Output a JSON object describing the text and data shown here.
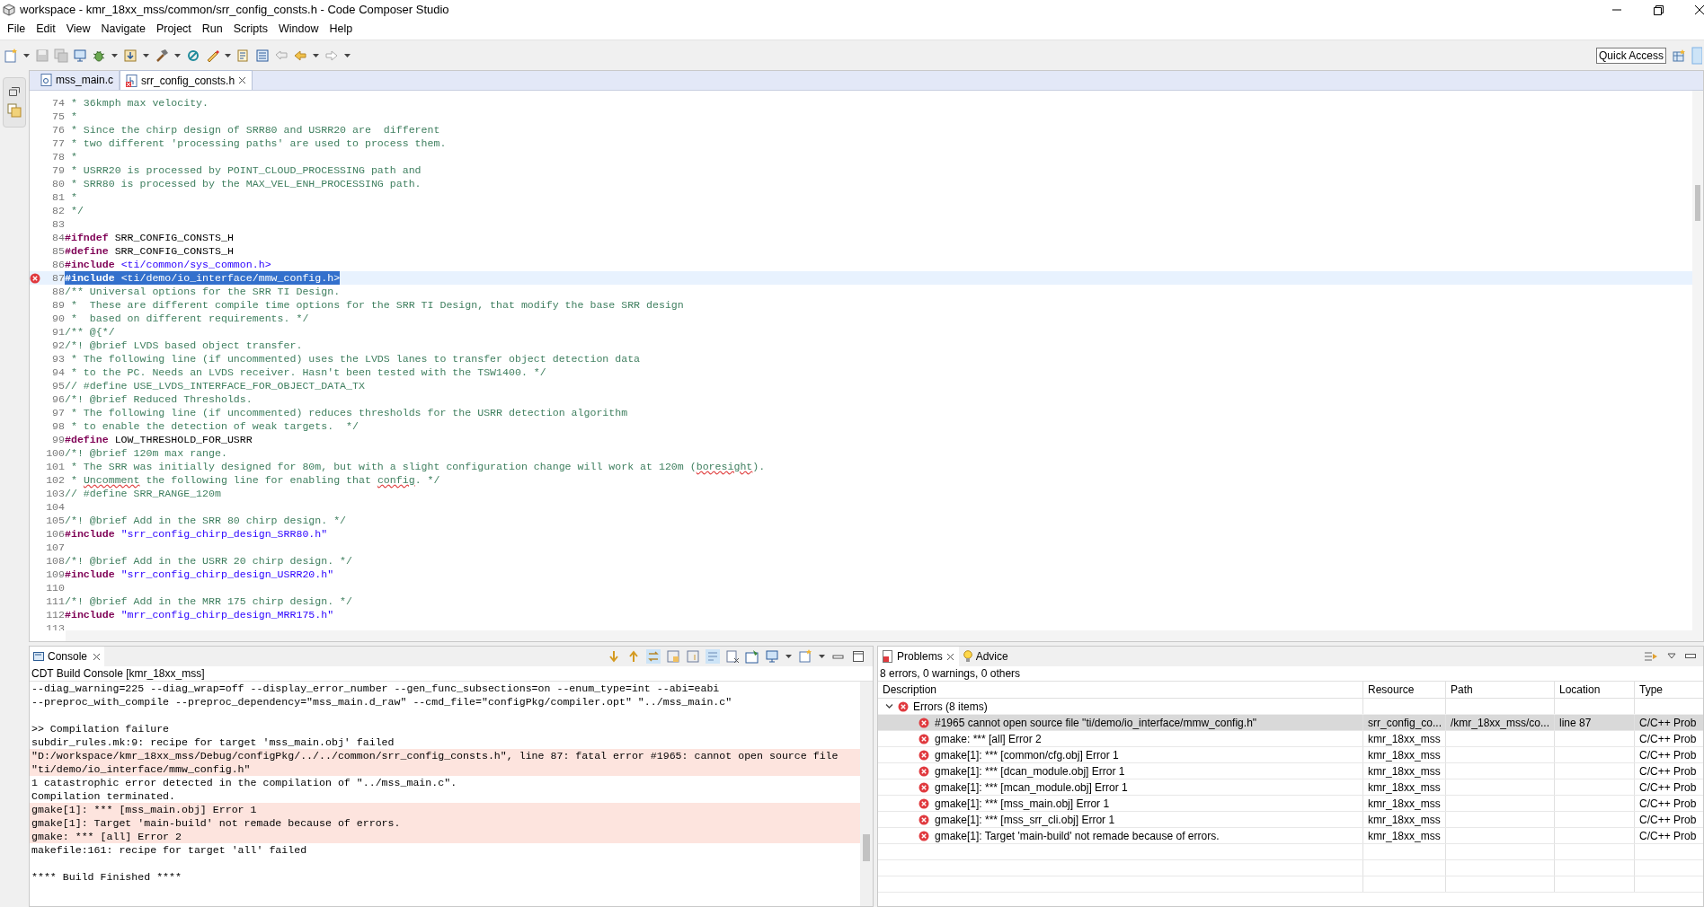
{
  "window": {
    "title": "workspace - kmr_18xx_mss/common/srr_config_consts.h - Code Composer Studio"
  },
  "menu": [
    "File",
    "Edit",
    "View",
    "Navigate",
    "Project",
    "Run",
    "Scripts",
    "Window",
    "Help"
  ],
  "toolbar": {
    "quick_access": "Quick Access"
  },
  "editor": {
    "tabs": [
      {
        "label": "mss_main.c",
        "kind": "c",
        "selected": false,
        "error": false
      },
      {
        "label": "srr_config_consts.h",
        "kind": "h",
        "selected": true,
        "error": true
      }
    ],
    "lines": [
      {
        "n": "74",
        "selected": false,
        "error": false,
        "segments": [
          {
            "text": " * 36kmph max velocity.",
            "kind": "comment"
          }
        ]
      },
      {
        "n": "75",
        "selected": false,
        "error": false,
        "segments": [
          {
            "text": " *",
            "kind": "comment"
          }
        ]
      },
      {
        "n": "76",
        "selected": false,
        "error": false,
        "segments": [
          {
            "text": " * Since the chirp design of SRR80 and USRR20 are  different",
            "kind": "comment"
          }
        ]
      },
      {
        "n": "77",
        "selected": false,
        "error": false,
        "segments": [
          {
            "text": " * two different 'processing paths' are used to process them.",
            "kind": "comment"
          }
        ]
      },
      {
        "n": "78",
        "selected": false,
        "error": false,
        "segments": [
          {
            "text": " *",
            "kind": "comment"
          }
        ]
      },
      {
        "n": "79",
        "selected": false,
        "error": false,
        "segments": [
          {
            "text": " * USRR20 is processed by POINT_CLOUD_PROCESSING path and",
            "kind": "comment"
          }
        ]
      },
      {
        "n": "80",
        "selected": false,
        "error": false,
        "segments": [
          {
            "text": " * SRR80 is processed by the MAX_VEL_ENH_PROCESSING path.",
            "kind": "comment"
          }
        ]
      },
      {
        "n": "81",
        "selected": false,
        "error": false,
        "segments": [
          {
            "text": " *",
            "kind": "comment"
          }
        ]
      },
      {
        "n": "82",
        "selected": false,
        "error": false,
        "segments": [
          {
            "text": " */",
            "kind": "comment"
          }
        ]
      },
      {
        "n": "83",
        "selected": false,
        "error": false
      },
      {
        "n": "84",
        "selected": false,
        "error": false,
        "segments": [
          {
            "text": "#ifndef",
            "kind": "directive"
          },
          {
            "text": " SRR_CONFIG_CONSTS_H",
            "kind": "plain"
          }
        ]
      },
      {
        "n": "85",
        "selected": false,
        "error": false,
        "segments": [
          {
            "text": "#define",
            "kind": "directive"
          },
          {
            "text": " SRR_CONFIG_CONSTS_H",
            "kind": "plain"
          }
        ]
      },
      {
        "n": "86",
        "selected": false,
        "error": false,
        "segments": [
          {
            "text": "#include",
            "kind": "directive"
          },
          {
            "text": " <ti/common/sys_common.h>",
            "kind": "string"
          }
        ]
      },
      {
        "n": "87",
        "selected": true,
        "error": true,
        "segments": [
          {
            "text": "#include",
            "kind": "directive"
          },
          {
            "text": " <ti/demo/io_interface/mmw_config.h>",
            "kind": "string"
          }
        ]
      },
      {
        "n": "88",
        "selected": false,
        "error": false,
        "segments": [
          {
            "text": "/** Universal options for the SRR TI Design.",
            "kind": "comment"
          }
        ]
      },
      {
        "n": "89",
        "selected": false,
        "error": false,
        "segments": [
          {
            "text": " *  These are different compile time options for the SRR TI Design, that modify the base SRR design",
            "kind": "comment"
          }
        ]
      },
      {
        "n": "90",
        "selected": false,
        "error": false,
        "segments": [
          {
            "text": " *  based on different requirements. */",
            "kind": "comment"
          }
        ]
      },
      {
        "n": "91",
        "selected": false,
        "error": false,
        "segments": [
          {
            "text": "/** @{*/",
            "kind": "comment"
          }
        ]
      },
      {
        "n": "92",
        "selected": false,
        "error": false,
        "segments": [
          {
            "text": "/*! @brief LVDS based object transfer.",
            "kind": "comment"
          }
        ]
      },
      {
        "n": "93",
        "selected": false,
        "error": false,
        "segments": [
          {
            "text": " * The following line (if uncommented) uses the LVDS lanes to transfer object detection data",
            "kind": "comment"
          }
        ]
      },
      {
        "n": "94",
        "selected": false,
        "error": false,
        "segments": [
          {
            "text": " * to the PC. Needs an LVDS receiver. Hasn't been tested with the TSW1400. */",
            "kind": "comment"
          }
        ]
      },
      {
        "n": "95",
        "selected": false,
        "error": false,
        "segments": [
          {
            "text": "// #define USE_LVDS_INTERFACE_FOR_OBJECT_DATA_TX",
            "kind": "comment"
          }
        ]
      },
      {
        "n": "96",
        "selected": false,
        "error": false,
        "segments": [
          {
            "text": "/*! @brief Reduced Thresholds.",
            "kind": "comment"
          }
        ]
      },
      {
        "n": "97",
        "selected": false,
        "error": false,
        "segments": [
          {
            "text": " * The following line (if uncommented) reduces thresholds for the USRR detection algorithm",
            "kind": "comment"
          }
        ]
      },
      {
        "n": "98",
        "selected": false,
        "error": false,
        "segments": [
          {
            "text": " * to enable the detection of weak targets.  */",
            "kind": "comment"
          }
        ]
      },
      {
        "n": "99",
        "selected": false,
        "error": false,
        "segments": [
          {
            "text": "#define",
            "kind": "directive"
          },
          {
            "text": " LOW_THRESHOLD_FOR_USRR",
            "kind": "plain"
          }
        ]
      },
      {
        "n": "100",
        "selected": false,
        "error": false,
        "segments": [
          {
            "text": "/*! @brief 120m max range.",
            "kind": "comment"
          }
        ]
      },
      {
        "n": "101",
        "selected": false,
        "error": false,
        "segments": [
          {
            "text": " * The SRR was initially designed for 80m, but with a slight configuration change will work at 120m (",
            "kind": "comment"
          },
          {
            "text": "boresight",
            "kind": "typo"
          },
          {
            "text": ").",
            "kind": "comment"
          }
        ]
      },
      {
        "n": "102",
        "selected": false,
        "error": false,
        "segments": [
          {
            "text": " * ",
            "kind": "comment"
          },
          {
            "text": "Uncomment",
            "kind": "typo"
          },
          {
            "text": " the following line for enabling that ",
            "kind": "comment"
          },
          {
            "text": "config",
            "kind": "typo"
          },
          {
            "text": ". */",
            "kind": "comment"
          }
        ]
      },
      {
        "n": "103",
        "selected": false,
        "error": false,
        "segments": [
          {
            "text": "// #define SRR_RANGE_120m",
            "kind": "comment"
          }
        ]
      },
      {
        "n": "104",
        "selected": false,
        "error": false
      },
      {
        "n": "105",
        "selected": false,
        "error": false,
        "segments": [
          {
            "text": "/*! @brief Add in the SRR 80 chirp design. */",
            "kind": "comment"
          }
        ]
      },
      {
        "n": "106",
        "selected": false,
        "error": false,
        "segments": [
          {
            "text": "#include",
            "kind": "directive"
          },
          {
            "text": " \"srr_config_chirp_design_SRR80.h\"",
            "kind": "string"
          }
        ]
      },
      {
        "n": "107",
        "selected": false,
        "error": false
      },
      {
        "n": "108",
        "selected": false,
        "error": false,
        "segments": [
          {
            "text": "/*! @brief Add in the USRR 20 chirp design. */",
            "kind": "comment"
          }
        ]
      },
      {
        "n": "109",
        "selected": false,
        "error": false,
        "segments": [
          {
            "text": "#include",
            "kind": "directive"
          },
          {
            "text": " \"srr_config_chirp_design_USRR20.h\"",
            "kind": "string"
          }
        ]
      },
      {
        "n": "110",
        "selected": false,
        "error": false
      },
      {
        "n": "111",
        "selected": false,
        "error": false,
        "segments": [
          {
            "text": "/*! @brief Add in the MRR 175 chirp design. */",
            "kind": "comment"
          }
        ]
      },
      {
        "n": "112",
        "selected": false,
        "error": false,
        "segments": [
          {
            "text": "#include",
            "kind": "directive"
          },
          {
            "text": " \"mrr_config_chirp_design_MRR175.h\"",
            "kind": "string"
          }
        ]
      },
      {
        "n": "113",
        "selected": false,
        "error": false
      }
    ]
  },
  "console": {
    "tab": "Console",
    "label": "CDT Build Console [kmr_18xx_mss]",
    "lines": [
      {
        "text": "--diag_warning=225 --diag_wrap=off --display_error_number --gen_func_subsections=on --enum_type=int --abi=eabi",
        "error": false
      },
      {
        "text": "--preproc_with_compile --preproc_dependency=\"mss_main.d_raw\" --cmd_file=\"configPkg/compiler.opt\" \"../mss_main.c\"",
        "error": false
      },
      {
        "error": false
      },
      {
        "text": ">> Compilation failure",
        "error": false
      },
      {
        "text": "subdir_rules.mk:9: recipe for target 'mss_main.obj' failed",
        "error": false
      },
      {
        "text": "\"D:/workspace/kmr_18xx_mss/Debug/configPkg/../../common/srr_config_consts.h\", line 87: fatal error #1965: cannot open source file",
        "error": true
      },
      {
        "text": "\"ti/demo/io_interface/mmw_config.h\"",
        "error": true
      },
      {
        "text": "1 catastrophic error detected in the compilation of \"../mss_main.c\".",
        "error": false
      },
      {
        "text": "Compilation terminated.",
        "error": false
      },
      {
        "text": "gmake[1]: *** [mss_main.obj] Error 1",
        "error": true
      },
      {
        "text": "gmake[1]: Target 'main-build' not remade because of errors.",
        "error": true
      },
      {
        "text": "gmake: *** [all] Error 2",
        "error": true
      },
      {
        "text": "makefile:161: recipe for target 'all' failed",
        "error": false
      },
      {
        "error": false
      },
      {
        "text": "**** Build Finished ****",
        "error": false
      }
    ]
  },
  "problems": {
    "tabs": [
      {
        "label": "Problems",
        "selected": true
      },
      {
        "label": "Advice",
        "selected": false
      }
    ],
    "summary": "8 errors, 0 warnings, 0 others",
    "columns": [
      "Description",
      "Resource",
      "Path",
      "Location",
      "Type"
    ],
    "group": {
      "label": "Errors (8 items)",
      "expanded": true
    },
    "rows": [
      {
        "description": "#1965 cannot open source file \"ti/demo/io_interface/mmw_config.h\"",
        "resource": "srr_config_co...",
        "path": "/kmr_18xx_mss/co...",
        "location": "line 87",
        "type": "C/C++ Prob",
        "selected": true
      },
      {
        "description": "gmake: *** [all] Error 2",
        "resource": "kmr_18xx_mss",
        "type": "C/C++ Prob",
        "selected": false
      },
      {
        "description": "gmake[1]: *** [common/cfg.obj] Error 1",
        "resource": "kmr_18xx_mss",
        "type": "C/C++ Prob",
        "selected": false
      },
      {
        "description": "gmake[1]: *** [dcan_module.obj] Error 1",
        "resource": "kmr_18xx_mss",
        "type": "C/C++ Prob",
        "selected": false
      },
      {
        "description": "gmake[1]: *** [mcan_module.obj] Error 1",
        "resource": "kmr_18xx_mss",
        "type": "C/C++ Prob",
        "selected": false
      },
      {
        "description": "gmake[1]: *** [mss_main.obj] Error 1",
        "resource": "kmr_18xx_mss",
        "type": "C/C++ Prob",
        "selected": false
      },
      {
        "description": "gmake[1]: *** [mss_srr_cli.obj] Error 1",
        "resource": "kmr_18xx_mss",
        "type": "C/C++ Prob",
        "selected": false
      },
      {
        "description": "gmake[1]: Target 'main-build' not remade because of errors.",
        "resource": "kmr_18xx_mss",
        "type": "C/C++ Prob",
        "selected": false
      }
    ]
  }
}
